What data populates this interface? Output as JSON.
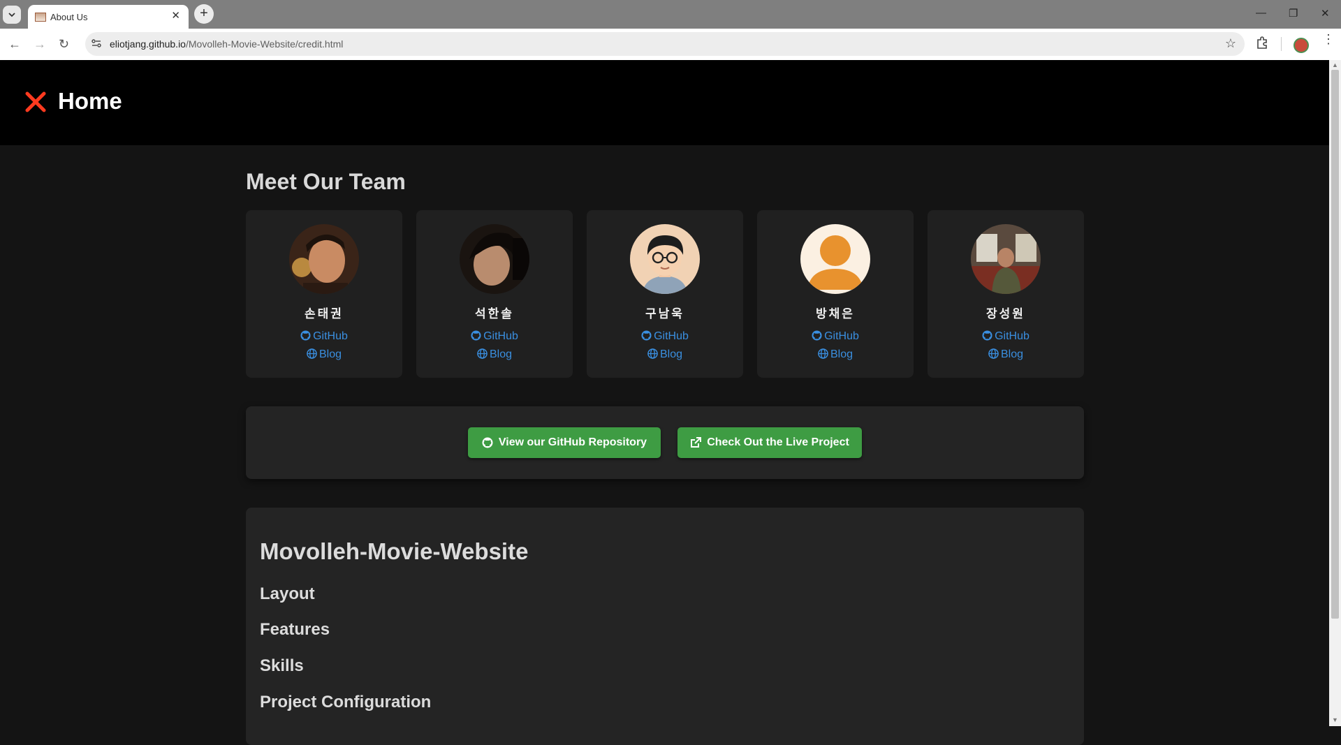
{
  "browser": {
    "tab_title": "About Us",
    "url_host": "eliotjang.github.io",
    "url_path": "/Movolleh-Movie-Website/credit.html"
  },
  "header": {
    "home_label": "Home",
    "home_icon_color": "#ff3a1f"
  },
  "team": {
    "title": "Meet Our Team",
    "github_label": "GitHub",
    "blog_label": "Blog",
    "members": [
      {
        "name": "손태권",
        "avatar": "photo"
      },
      {
        "name": "석한솔",
        "avatar": "photo"
      },
      {
        "name": "구남욱",
        "avatar": "cartoon"
      },
      {
        "name": "방채은",
        "avatar": "default-person"
      },
      {
        "name": "장성원",
        "avatar": "photo"
      }
    ]
  },
  "cta": {
    "repo_button": "View our GitHub Repository",
    "live_button": "Check Out the Live Project",
    "button_color": "#3e9c43"
  },
  "readme": {
    "title": "Movolleh-Movie-Website",
    "sections": [
      "Layout",
      "Features",
      "Skills",
      "Project Configuration"
    ]
  },
  "colors": {
    "page_bg": "#141414",
    "card_bg": "#202020",
    "link": "#3a8fe0"
  }
}
